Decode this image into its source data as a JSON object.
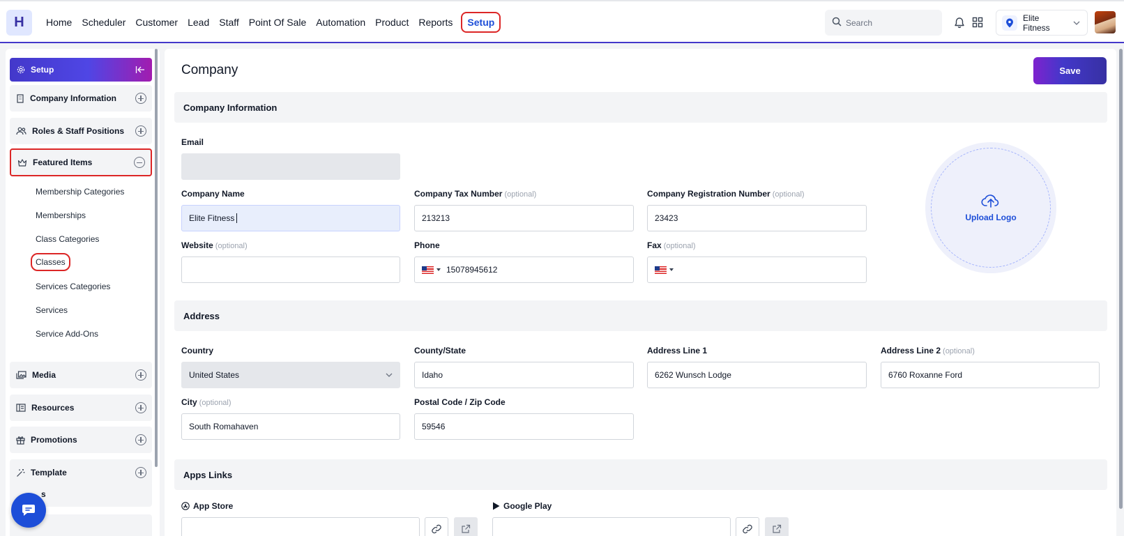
{
  "app": {
    "logo_letter": "H"
  },
  "nav": {
    "items": [
      "Home",
      "Scheduler",
      "Customer",
      "Lead",
      "Staff",
      "Point Of Sale",
      "Automation",
      "Product",
      "Reports"
    ],
    "active": "Setup"
  },
  "search": {
    "placeholder": "Search"
  },
  "location": {
    "name": "Elite Fitness"
  },
  "sidebar": {
    "header": "Setup",
    "sections": {
      "company_information": "Company Information",
      "roles": "Roles & Staff Positions",
      "featured_items": "Featured Items",
      "media": "Media",
      "resources": "Resources",
      "promotions": "Promotions",
      "template": "Template",
      "partial": "s"
    },
    "featured_sub": [
      "Membership Categories",
      "Memberships",
      "Class Categories",
      "Classes",
      "Services Categories",
      "Services",
      "Service Add-Ons"
    ]
  },
  "page": {
    "title": "Company",
    "save_label": "Save"
  },
  "company_info": {
    "heading": "Company Information",
    "email_label": "Email",
    "email_value": "",
    "company_name_label": "Company Name",
    "company_name_value": "Elite Fitness",
    "tax_label": "Company Tax Number",
    "tax_value": "213213",
    "reg_label": "Company Registration Number",
    "reg_value": "23423",
    "website_label": "Website",
    "website_value": "",
    "phone_label": "Phone",
    "phone_value": "15078945612",
    "fax_label": "Fax",
    "fax_value": "",
    "optional": "(optional)",
    "upload_label": "Upload Logo"
  },
  "address": {
    "heading": "Address",
    "country_label": "Country",
    "country_value": "United States",
    "state_label": "County/State",
    "state_value": "Idaho",
    "line1_label": "Address Line 1",
    "line1_value": "6262 Wunsch Lodge",
    "line2_label": "Address Line 2",
    "line2_value": "6760 Roxanne Ford",
    "city_label": "City",
    "city_value": "South Romahaven",
    "postal_label": "Postal Code / Zip Code",
    "postal_value": "59546"
  },
  "apps_links": {
    "heading": "Apps Links",
    "app_store_label": "App Store",
    "google_play_label": "Google Play"
  },
  "colors": {
    "accent": "#4338ca",
    "highlight": "#dc2626",
    "link": "#1d4ed8"
  }
}
